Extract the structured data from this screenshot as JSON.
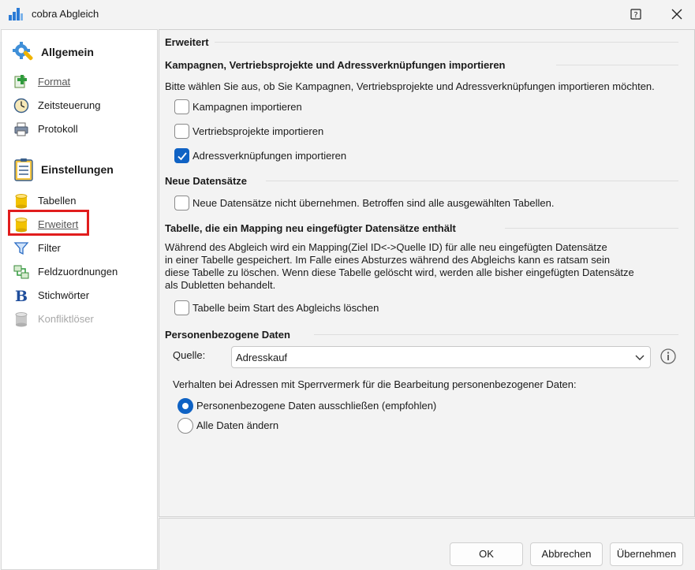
{
  "window": {
    "title": "cobra Abgleich"
  },
  "sidebar": {
    "groups": [
      {
        "label": "Allgemein",
        "icon": "gear-wrench-icon",
        "items": [
          {
            "label": "Format",
            "icon": "format-plus-icon",
            "style": "link"
          },
          {
            "label": "Zeitsteuerung",
            "icon": "clock-icon"
          },
          {
            "label": "Protokoll",
            "icon": "printer-icon"
          }
        ]
      },
      {
        "label": "Einstellungen",
        "icon": "clipboard-list-icon",
        "items": [
          {
            "label": "Tabellen",
            "icon": "database-icon"
          },
          {
            "label": "Erweitert",
            "icon": "database-icon",
            "style": "link",
            "highlighted": true
          },
          {
            "label": "Filter",
            "icon": "filter-icon"
          },
          {
            "label": "Feldzuordnungen",
            "icon": "field-mapping-icon"
          },
          {
            "label": "Stichwörter",
            "icon": "bold-b-icon"
          },
          {
            "label": "Konfliktlöser",
            "icon": "database-gray-icon",
            "disabled": true
          }
        ]
      }
    ]
  },
  "main": {
    "title": "Erweitert",
    "import": {
      "heading": "Kampagnen, Vertriebsprojekte und Adressverknüpfungen importieren",
      "description": "Bitte wählen Sie aus, ob Sie Kampagnen, Vertriebsprojekte und Adressverknüpfungen importieren möchten.",
      "options": [
        {
          "label": "Kampagnen importieren",
          "checked": false
        },
        {
          "label": "Vertriebsprojekte importieren",
          "checked": false
        },
        {
          "label": "Adressverknüpfungen importieren",
          "checked": true
        }
      ]
    },
    "new_records": {
      "heading": "Neue Datensätze",
      "option": {
        "label": "Neue Datensätze nicht übernehmen. Betroffen sind alle ausgewählten Tabellen.",
        "checked": false
      }
    },
    "mapping": {
      "heading": "Tabelle, die ein Mapping neu eingefügter Datensätze enthält",
      "lines": [
        "Während des Abgleich wird ein Mapping(Ziel ID<->Quelle ID) für alle neu eingefügten Datensätze",
        "in einer Tabelle gespeichert. Im Falle eines Absturzes während des Abgleichs kann es ratsam sein",
        "diese Tabelle zu löschen. Wenn diese Tabelle gelöscht wird, werden alle bisher eingefügten Datensätze",
        "als Dubletten behandelt."
      ],
      "option": {
        "label": "Tabelle beim Start des Abgleichs löschen",
        "checked": false
      }
    },
    "personal": {
      "heading": "Personenbezogene Daten",
      "source_label": "Quelle:",
      "source_value": "Adresskauf",
      "behavior_text": "Verhalten bei Adressen mit Sperrvermerk für die Bearbeitung personenbezogener Daten:",
      "radios": [
        {
          "label": "Personenbezogene Daten ausschließen (empfohlen)",
          "selected": true
        },
        {
          "label": "Alle Daten ändern",
          "selected": false
        }
      ]
    }
  },
  "footer": {
    "ok": "OK",
    "cancel": "Abbrechen",
    "apply": "Übernehmen"
  },
  "colors": {
    "accent": "#0f62c4",
    "highlight_border": "#e11d1d",
    "database_yellow": "#f2c200"
  }
}
